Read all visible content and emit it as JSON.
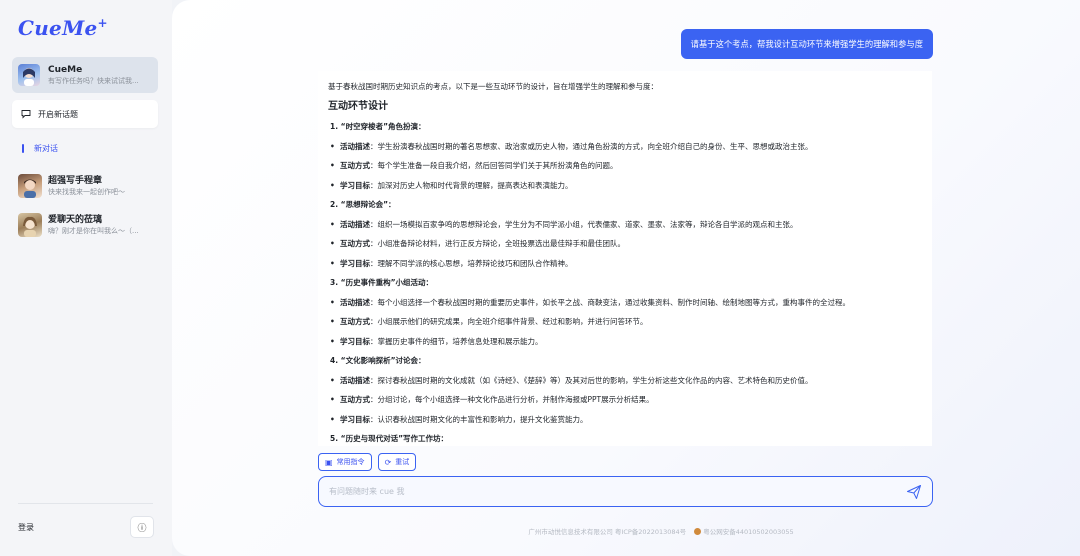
{
  "sidebar": {
    "logo": "CueMe",
    "logo_plus": "+",
    "profile": {
      "name": "CueMe",
      "subtitle": "有写作任务吗？快来试试我..."
    },
    "new_topic_label": "开启新话题",
    "new_chat_label": "新对话",
    "conversations": [
      {
        "title": "超强写手程章",
        "subtitle": "快来找我来一起创作吧～"
      },
      {
        "title": "爱聊天的莅璃",
        "subtitle": "嗨？刚才是你在叫我么～（..."
      }
    ],
    "login_label": "登录",
    "info_icon": "ⓘ"
  },
  "chat": {
    "user_message": "请基于这个考点，帮我设计互动环节来增强学生的理解和参与度",
    "answer": {
      "intro": "基于春秋战国时期历史知识点的考点，以下是一些互动环节的设计，旨在增强学生的理解和参与度：",
      "section_title": "互动环节设计",
      "items": [
        {
          "type": "heading",
          "text": "1. “时空穿梭者”角色扮演："
        },
        {
          "type": "bullet",
          "label": "活动描述",
          "text": "：学生扮演春秋战国时期的著名思想家、政治家或历史人物，通过角色扮演的方式，向全班介绍自己的身份、生平、思想或政治主张。"
        },
        {
          "type": "bullet",
          "label": "互动方式",
          "text": "：每个学生准备一段自我介绍，然后回答同学们关于其所扮演角色的问题。"
        },
        {
          "type": "bullet",
          "label": "学习目标",
          "text": "：加深对历史人物和时代背景的理解，提高表达和表演能力。"
        },
        {
          "type": "heading",
          "text": "2. “思想辩论会”："
        },
        {
          "type": "bullet",
          "label": "活动描述",
          "text": "：组织一场模拟百家争鸣的思想辩论会，学生分为不同学派小组，代表儒家、道家、墨家、法家等，辩论各自学派的观点和主张。"
        },
        {
          "type": "bullet",
          "label": "互动方式",
          "text": "：小组准备辩论材料，进行正反方辩论，全班投票选出最佳辩手和最佳团队。"
        },
        {
          "type": "bullet",
          "label": "学习目标",
          "text": "：理解不同学派的核心思想，培养辩论技巧和团队合作精神。"
        },
        {
          "type": "heading",
          "text": "3. “历史事件重构”小组活动："
        },
        {
          "type": "bullet",
          "label": "活动描述",
          "text": "：每个小组选择一个春秋战国时期的重要历史事件，如长平之战、商鞅变法，通过收集资料、制作时间轴、绘制地图等方式，重构事件的全过程。"
        },
        {
          "type": "bullet",
          "label": "互动方式",
          "text": "：小组展示他们的研究成果，向全班介绍事件背景、经过和影响，并进行问答环节。"
        },
        {
          "type": "bullet",
          "label": "学习目标",
          "text": "：掌握历史事件的细节，培养信息处理和展示能力。"
        },
        {
          "type": "heading",
          "text": "4. “文化影响探析”讨论会："
        },
        {
          "type": "bullet",
          "label": "活动描述",
          "text": "：探讨春秋战国时期的文化成就（如《诗经》、《楚辞》等）及其对后世的影响，学生分析这些文化作品的内容、艺术特色和历史价值。"
        },
        {
          "type": "bullet",
          "label": "互动方式",
          "text": "：分组讨论，每个小组选择一种文化作品进行分析，并制作海报或PPT展示分析结果。"
        },
        {
          "type": "bullet",
          "label": "学习目标",
          "text": "：认识春秋战国时期文化的丰富性和影响力，提升文化鉴赏能力。"
        },
        {
          "type": "heading",
          "text": "5. “历史与现代对话”写作工作坊："
        }
      ]
    },
    "actions": [
      {
        "icon": "▣",
        "label": "常用指令"
      },
      {
        "icon": "⟳",
        "label": "重试"
      }
    ],
    "input_placeholder": "有问题随时来 cue 我"
  },
  "footer": {
    "company": "广州市动悦信息技术有限公司 粤ICP备2022013084号",
    "police": "粤公网安备44010502003055"
  },
  "colors": {
    "accent": "#3b63f2",
    "logo": "#3b52f0"
  }
}
